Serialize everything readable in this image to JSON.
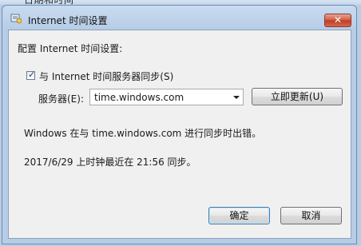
{
  "background_window": {
    "title": "日期和时间"
  },
  "dialog": {
    "title": "Internet 时间设置",
    "close_symbol": "✕",
    "title_icon": "clock-settings-icon"
  },
  "settings": {
    "heading": "配置 Internet 时间设置:",
    "sync_checkbox_label": "与 Internet 时间服务器同步(S)",
    "sync_checked": true,
    "server_label": "服务器(E):",
    "server_value": "time.windows.com",
    "update_button": "立即更新(U)"
  },
  "status": {
    "error_message": "Windows 在与 time.windows.com 进行同步时出错。",
    "last_sync": "2017/6/29 上时钟最近在 21:56 同步。"
  },
  "footer": {
    "ok_button": "确定",
    "cancel_button": "取消"
  }
}
